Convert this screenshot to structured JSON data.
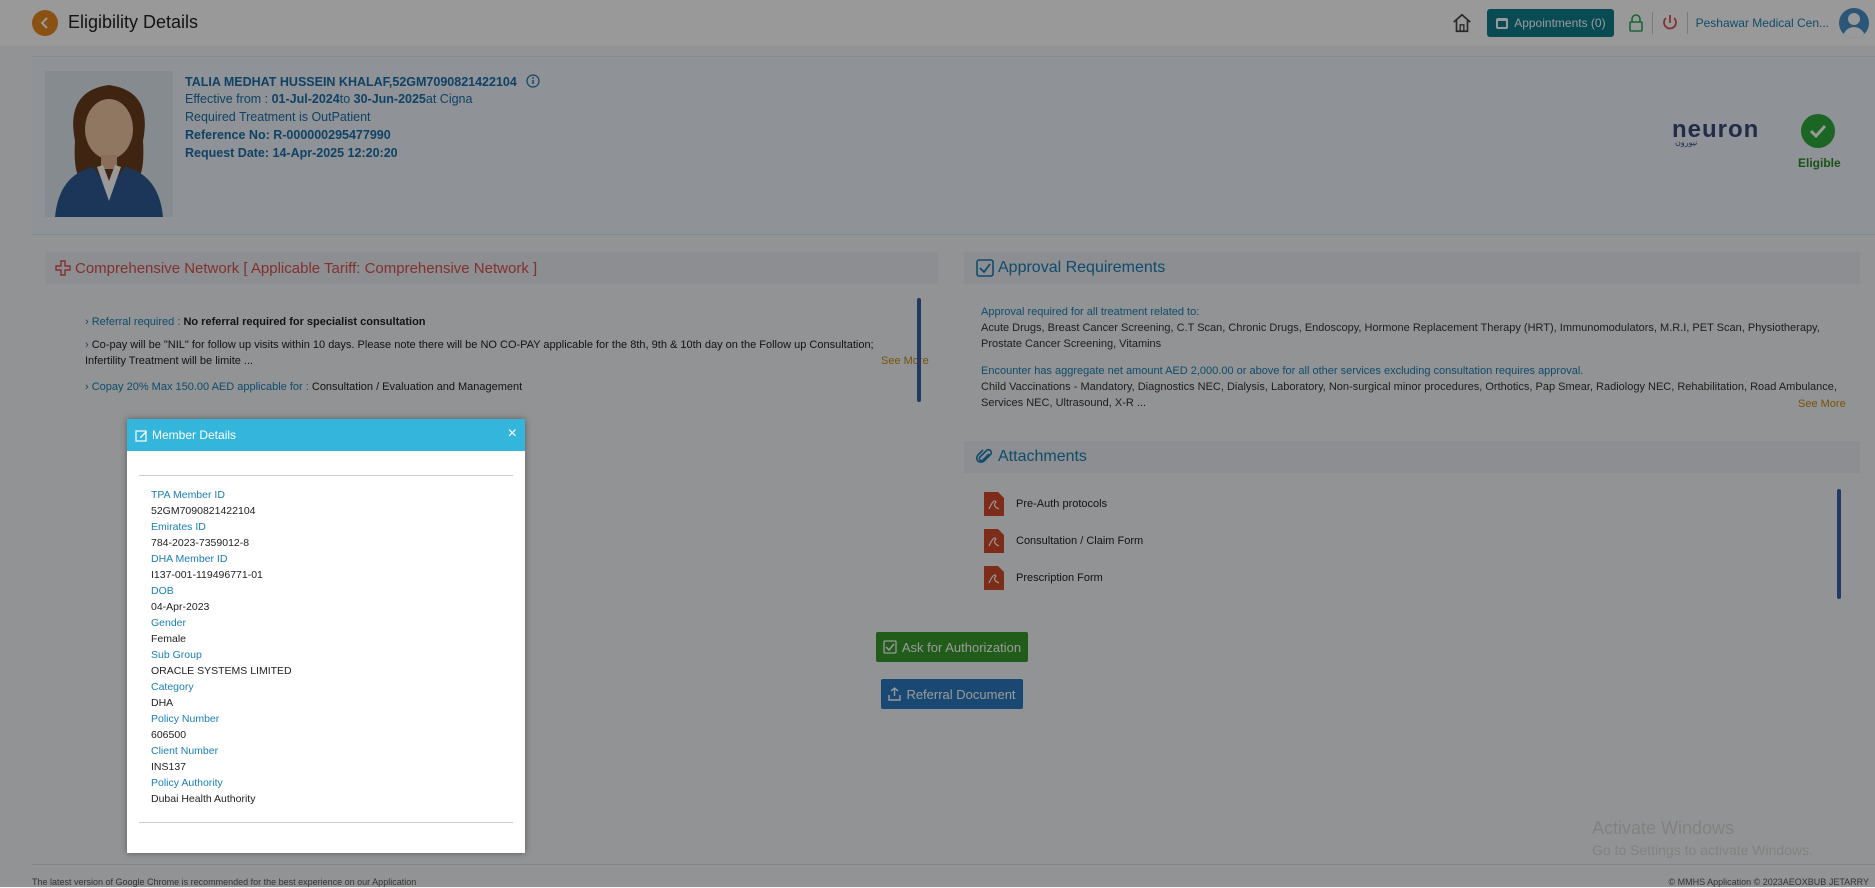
{
  "header": {
    "title": "Eligibility Details",
    "appointments_label": "Appointments (0)",
    "clinic_name": "Peshawar Medical Cen..."
  },
  "member": {
    "name_line": "TALIA MEDHAT HUSSEIN KHALAF,52GM7090821422104",
    "effective_prefix": "Effective from : ",
    "effective_from": "01-Jul-2024",
    "effective_to_prefix": "to ",
    "effective_to": "30-Jun-2025",
    "effective_at": "at Cigna",
    "treatment": "Required Treatment is OutPatient",
    "reference": "Reference No: R-000000295477990",
    "request_date": "Request Date: 14-Apr-2025 12:20:20",
    "eligibility_status": "Eligible",
    "provider_logo": "neuron",
    "provider_logo_sub": "نيورون"
  },
  "network": {
    "title": "Comprehensive Network [ Applicable Tariff: Comprehensive Network ]",
    "items": [
      {
        "key": "Referral required :",
        "value": "No referral required for specialist consultation"
      },
      {
        "key": "",
        "value": "Co-pay will be \"NIL\" for follow up visits within 10 days. Please note there will be NO CO-PAY applicable for the 8th, 9th & 10th day on the Follow up Consultation; Infertility Treatment will be limite ..."
      },
      {
        "key": "Copay 20% Max 150.00 AED applicable for :",
        "value": " Consultation / Evaluation and Management"
      }
    ],
    "see_more": "See More"
  },
  "approval": {
    "title": "Approval Requirements",
    "label_1": "Approval required for all treatment related to:",
    "text_1": "Acute Drugs, Breast Cancer Screening, C.T Scan, Chronic Drugs, Endoscopy, Hormone Replacement Therapy (HRT), Immunomodulators, M.R.I, PET Scan, Physiotherapy, Prostate Cancer Screening, Vitamins",
    "label_2": "Encounter has aggregate net amount AED 2,000.00 or above for all other services excluding consultation requires approval.",
    "text_2": "Child Vaccinations - Mandatory, Diagnostics NEC, Dialysis, Laboratory, Non-surgical minor procedures, Orthotics, Pap Smear, Radiology NEC, Rehabilitation, Road Ambulance, Services NEC, Ultrasound, X-R ...",
    "see_more": "See More"
  },
  "attachments": {
    "title": "Attachments",
    "items": [
      "Pre-Auth protocols",
      "Consultation / Claim Form",
      "Prescription Form"
    ]
  },
  "actions": {
    "ask_auth": "Ask for Authorization",
    "referral_doc": "Referral Document"
  },
  "modal": {
    "title": "Member Details",
    "close": "×",
    "fields": [
      {
        "label": "TPA Member ID",
        "value": "52GM7090821422104"
      },
      {
        "label": "Emirates ID",
        "value": "784-2023-7359012-8"
      },
      {
        "label": "DHA Member ID",
        "value": "I137-001-119496771-01"
      },
      {
        "label": "DOB",
        "value": "04-Apr-2023"
      },
      {
        "label": "Gender",
        "value": "Female"
      },
      {
        "label": "Sub Group",
        "value": "ORACLE SYSTEMS LIMITED"
      },
      {
        "label": "Category",
        "value": "DHA"
      },
      {
        "label": "Policy Number",
        "value": "606500"
      },
      {
        "label": "Client Number",
        "value": "INS137"
      },
      {
        "label": "Policy Authority",
        "value": "Dubai Health Authority"
      }
    ]
  },
  "footer": {
    "left": "The latest version of Google Chrome is recommended for the best experience on our Application",
    "right": "© MMHS Application © 2023AEOXBUB JETARRY"
  },
  "watermark": {
    "line1": "Activate Windows",
    "line2": "Go to Settings to activate Windows."
  },
  "colors": {
    "accent": "#1a7fb5",
    "modal_header": "#34b5dc",
    "eligible": "#2eaa3c",
    "auth_button": "#3a9a2e",
    "referral_button": "#2a7ac0",
    "back_button": "#e8871f"
  }
}
